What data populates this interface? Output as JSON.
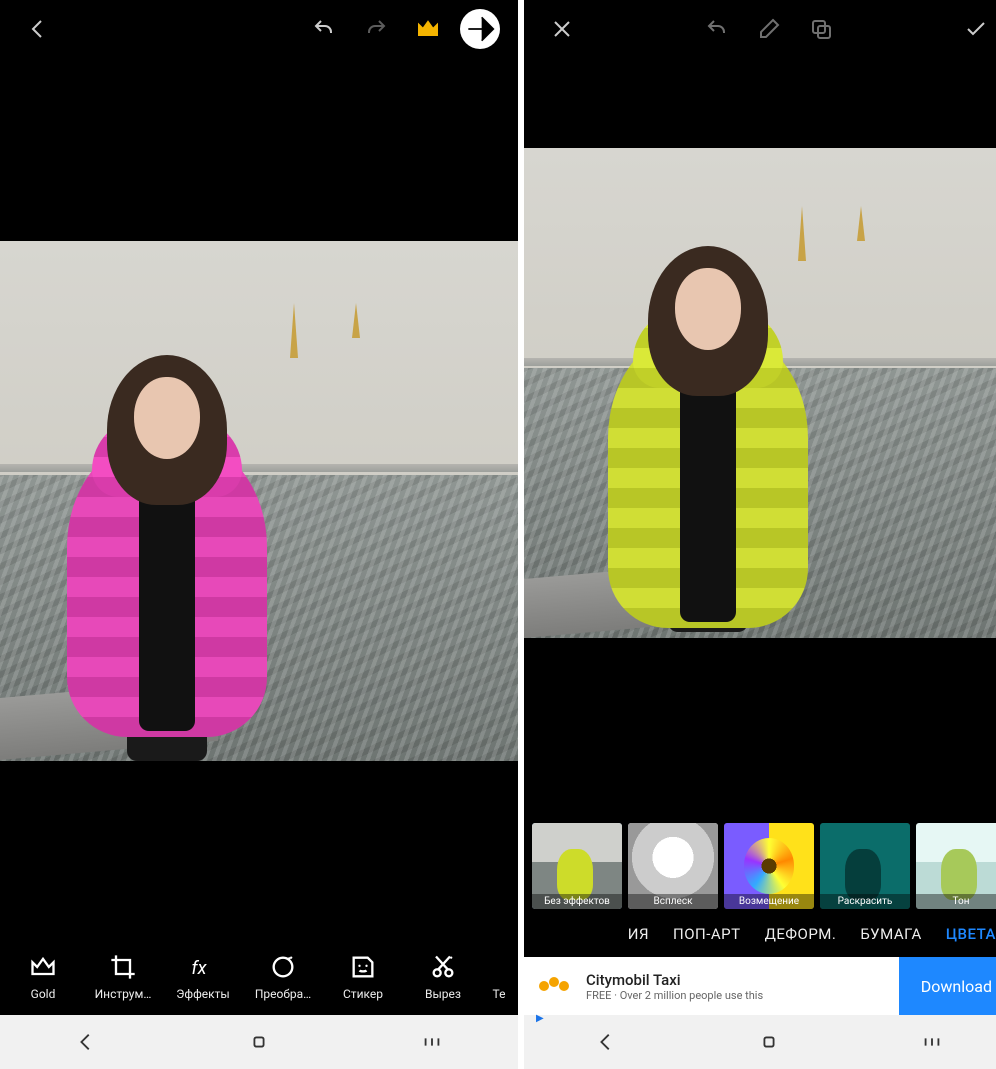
{
  "left": {
    "topbar": {
      "back": "back-icon",
      "undo": "undo-icon",
      "redo": "redo-icon",
      "premium": "crown-icon",
      "forward": "forward-icon"
    },
    "coat_color": "#e63fb5",
    "tools": [
      {
        "id": "gold",
        "label": "Gold"
      },
      {
        "id": "tools",
        "label": "Инструм…"
      },
      {
        "id": "effects",
        "label": "Эффекты"
      },
      {
        "id": "transform",
        "label": "Преобра…"
      },
      {
        "id": "sticker",
        "label": "Стикер"
      },
      {
        "id": "cutout",
        "label": "Вырез"
      },
      {
        "id": "text",
        "label": "Те"
      }
    ],
    "nav": [
      "back",
      "home",
      "recents"
    ]
  },
  "right": {
    "topbar": {
      "close": "close-icon",
      "undo": "undo-icon",
      "eraser": "eraser-icon",
      "compare": "compare-icon",
      "apply": "check-icon"
    },
    "coat_color": "#cddc2a",
    "filters": [
      {
        "id": "none",
        "label": "Без эффектов",
        "selected": true
      },
      {
        "id": "splash",
        "label": "Всплеск"
      },
      {
        "id": "replace",
        "label": "Возмещение"
      },
      {
        "id": "colorize",
        "label": "Раскрасить"
      },
      {
        "id": "tone",
        "label": "Тон"
      }
    ],
    "categories": [
      {
        "id": "ia",
        "label": "ИЯ",
        "partial": true
      },
      {
        "id": "popart",
        "label": "ПОП-АРТ"
      },
      {
        "id": "deform",
        "label": "ДЕФОРМ."
      },
      {
        "id": "paper",
        "label": "БУМАГА"
      },
      {
        "id": "colors",
        "label": "ЦВЕТА",
        "active": true
      }
    ],
    "ad": {
      "title": "Citymobil Taxi",
      "subtitle": "FREE · Over 2 million people use this",
      "cta": "Download"
    },
    "nav": [
      "back",
      "home",
      "recents"
    ]
  }
}
